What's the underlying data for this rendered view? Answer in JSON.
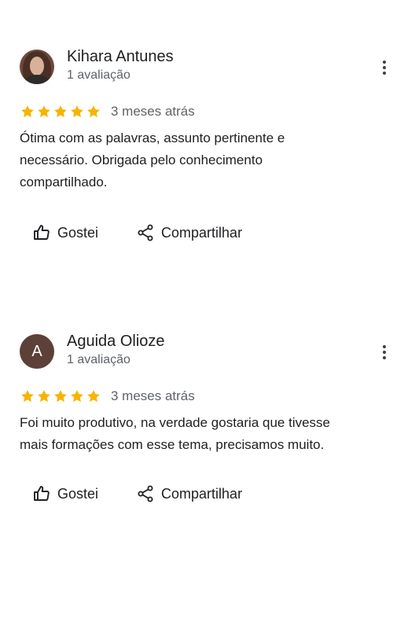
{
  "colors": {
    "star": "#f6b400",
    "avatar_letter_bg": "#5d4037",
    "text_primary": "#1f1f1f",
    "text_secondary": "#5f6368"
  },
  "reviews": [
    {
      "author": "Kihara Antunes",
      "meta": "1 avaliação",
      "avatar_type": "photo",
      "rating": 5,
      "time": "3 meses atrás",
      "text": "Ótima com as palavras, assunto pertinente e necessário. Obrigada pelo conhecimento compartilhado.",
      "like_label": "Gostei",
      "share_label": "Compartilhar"
    },
    {
      "author": "Aguida Olioze",
      "meta": "1 avaliação",
      "avatar_type": "letter",
      "avatar_letter": "A",
      "rating": 5,
      "time": "3 meses atrás",
      "text": "Foi muito produtivo, na verdade gostaria que tivesse mais formações com esse tema, precisamos muito.",
      "like_label": "Gostei",
      "share_label": "Compartilhar"
    }
  ],
  "icons": {
    "star": "star-icon",
    "like": "thumbs-up-icon",
    "share": "share-icon",
    "more": "more-vert-icon"
  }
}
